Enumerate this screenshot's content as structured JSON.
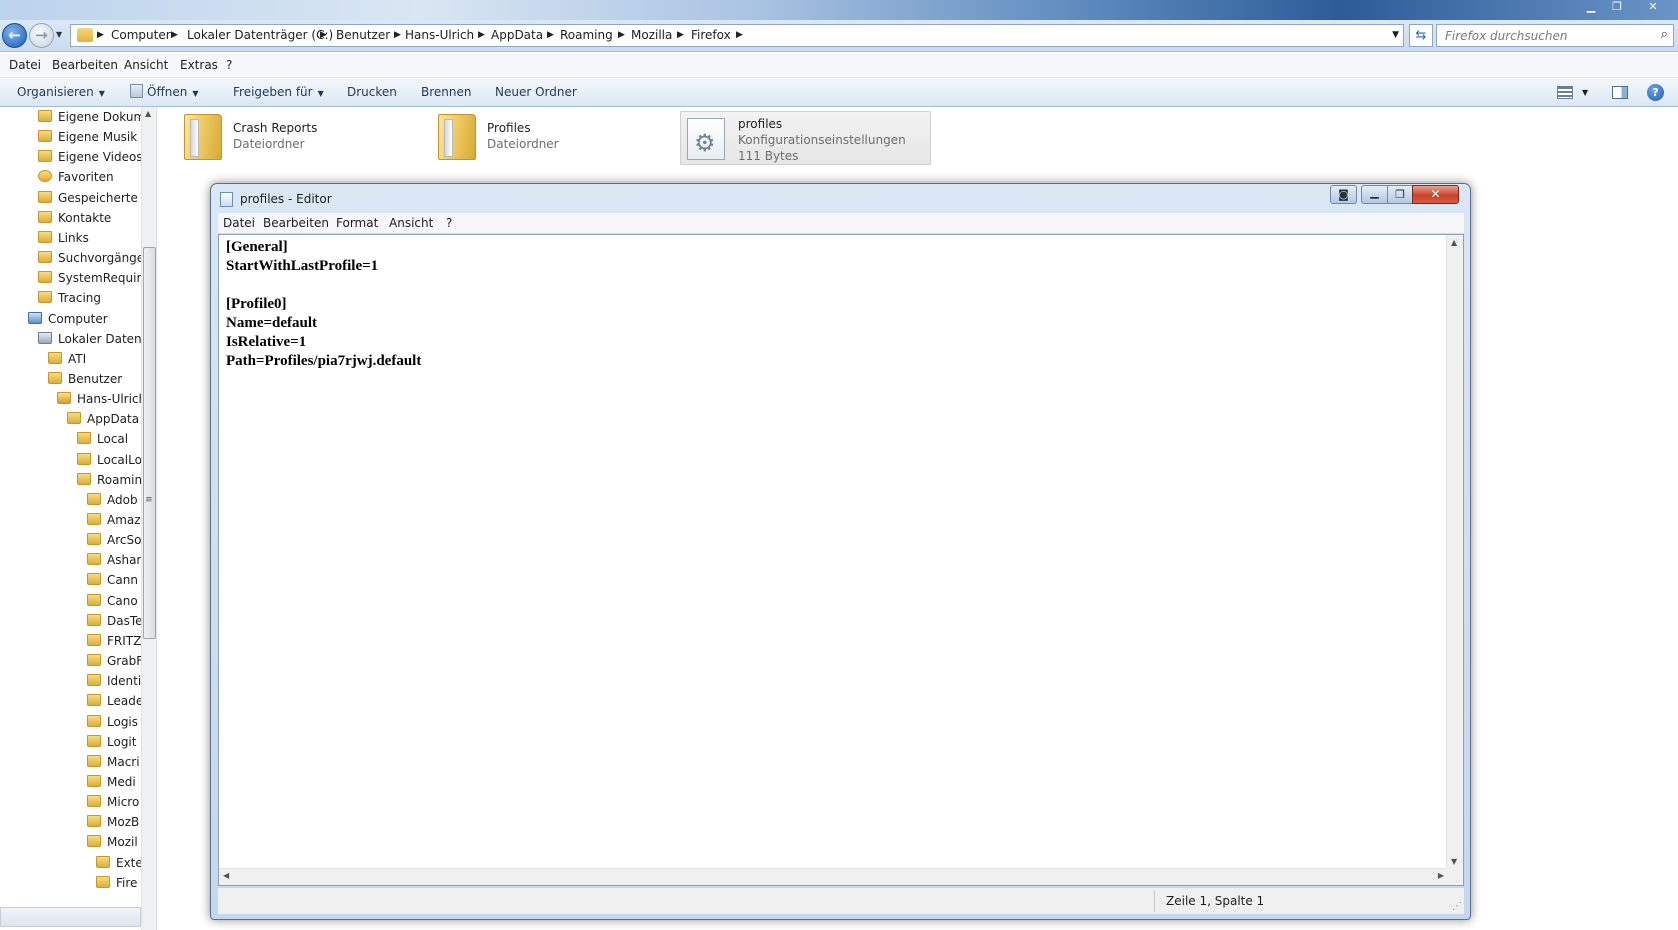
{
  "explorer": {
    "address": {
      "crumbs": [
        "Computer",
        "Lokaler Datenträger (C:)",
        "Benutzer",
        "Hans-Ulrich",
        "AppData",
        "Roaming",
        "Mozilla",
        "Firefox"
      ]
    },
    "search": {
      "placeholder": "Firefox durchsuchen"
    },
    "menu": [
      "Datei",
      "Bearbeiten",
      "Ansicht",
      "Extras",
      "?"
    ],
    "commands": {
      "organize": "Organisieren",
      "open": "Öffnen",
      "share": "Freigeben für",
      "print": "Drucken",
      "burn": "Brennen",
      "new_folder": "Neuer Ordner"
    },
    "tree": [
      {
        "label": "Eigene Dokume",
        "icon": "folder-icon"
      },
      {
        "label": "Eigene Musik",
        "icon": "folder-icon"
      },
      {
        "label": "Eigene Videos",
        "icon": "folder-icon"
      },
      {
        "label": "Favoriten",
        "icon": "star-folder-icon"
      },
      {
        "label": "Gespeicherte Sp",
        "icon": "folder-icon"
      },
      {
        "label": "Kontakte",
        "icon": "folder-icon"
      },
      {
        "label": "Links",
        "icon": "folder-icon"
      },
      {
        "label": "Suchvorgänge",
        "icon": "folder-icon"
      },
      {
        "label": "SystemRequire",
        "icon": "folder-icon"
      },
      {
        "label": "Tracing",
        "icon": "folder-icon"
      },
      {
        "label": "Computer",
        "icon": "computer-icon"
      },
      {
        "label": "Lokaler Datentr",
        "icon": "drive-icon"
      },
      {
        "label": "ATI",
        "icon": "folder-icon"
      },
      {
        "label": "Benutzer",
        "icon": "folder-icon"
      },
      {
        "label": "Hans-Ulrich",
        "icon": "user-folder-icon"
      },
      {
        "label": "AppData",
        "icon": "folder-icon"
      },
      {
        "label": "Local",
        "icon": "folder-icon"
      },
      {
        "label": "LocalLo",
        "icon": "folder-icon"
      },
      {
        "label": "Roamin",
        "icon": "folder-icon"
      },
      {
        "label": "Adob",
        "icon": "folder-icon"
      },
      {
        "label": "Amaz",
        "icon": "folder-icon"
      },
      {
        "label": "ArcSo",
        "icon": "folder-icon"
      },
      {
        "label": "Ashar",
        "icon": "folder-icon"
      },
      {
        "label": "Cann",
        "icon": "folder-icon"
      },
      {
        "label": "Cano",
        "icon": "folder-icon"
      },
      {
        "label": "DasTe",
        "icon": "folder-icon"
      },
      {
        "label": "FRITZ",
        "icon": "folder-icon"
      },
      {
        "label": "GrabF",
        "icon": "folder-icon"
      },
      {
        "label": "Identi",
        "icon": "folder-icon"
      },
      {
        "label": "Leade",
        "icon": "folder-icon"
      },
      {
        "label": "Logis",
        "icon": "folder-icon"
      },
      {
        "label": "Logit",
        "icon": "folder-icon"
      },
      {
        "label": "Macri",
        "icon": "folder-icon"
      },
      {
        "label": "Medi",
        "icon": "folder-icon"
      },
      {
        "label": "Micro",
        "icon": "folder-icon"
      },
      {
        "label": "MozB",
        "icon": "folder-icon"
      },
      {
        "label": "Mozil",
        "icon": "folder-icon"
      },
      {
        "label": "Exte",
        "icon": "folder-icon"
      },
      {
        "label": "Fire",
        "icon": "folder-icon"
      }
    ],
    "files": [
      {
        "name": "Crash Reports",
        "type": "Dateiordner"
      },
      {
        "name": "Profiles",
        "type": "Dateiordner"
      },
      {
        "name": "profiles",
        "type": "Konfigurationseinstellungen",
        "size": "111 Bytes"
      }
    ]
  },
  "notepad": {
    "title": "profiles - Editor",
    "menu": [
      "Datei",
      "Bearbeiten",
      "Format",
      "Ansicht",
      "?"
    ],
    "content": "[General]\nStartWithLastProfile=1\n\n[Profile0]\nName=default\nIsRelative=1\nPath=Profiles/pia7rjwj.default",
    "status": "Zeile 1, Spalte 1"
  }
}
